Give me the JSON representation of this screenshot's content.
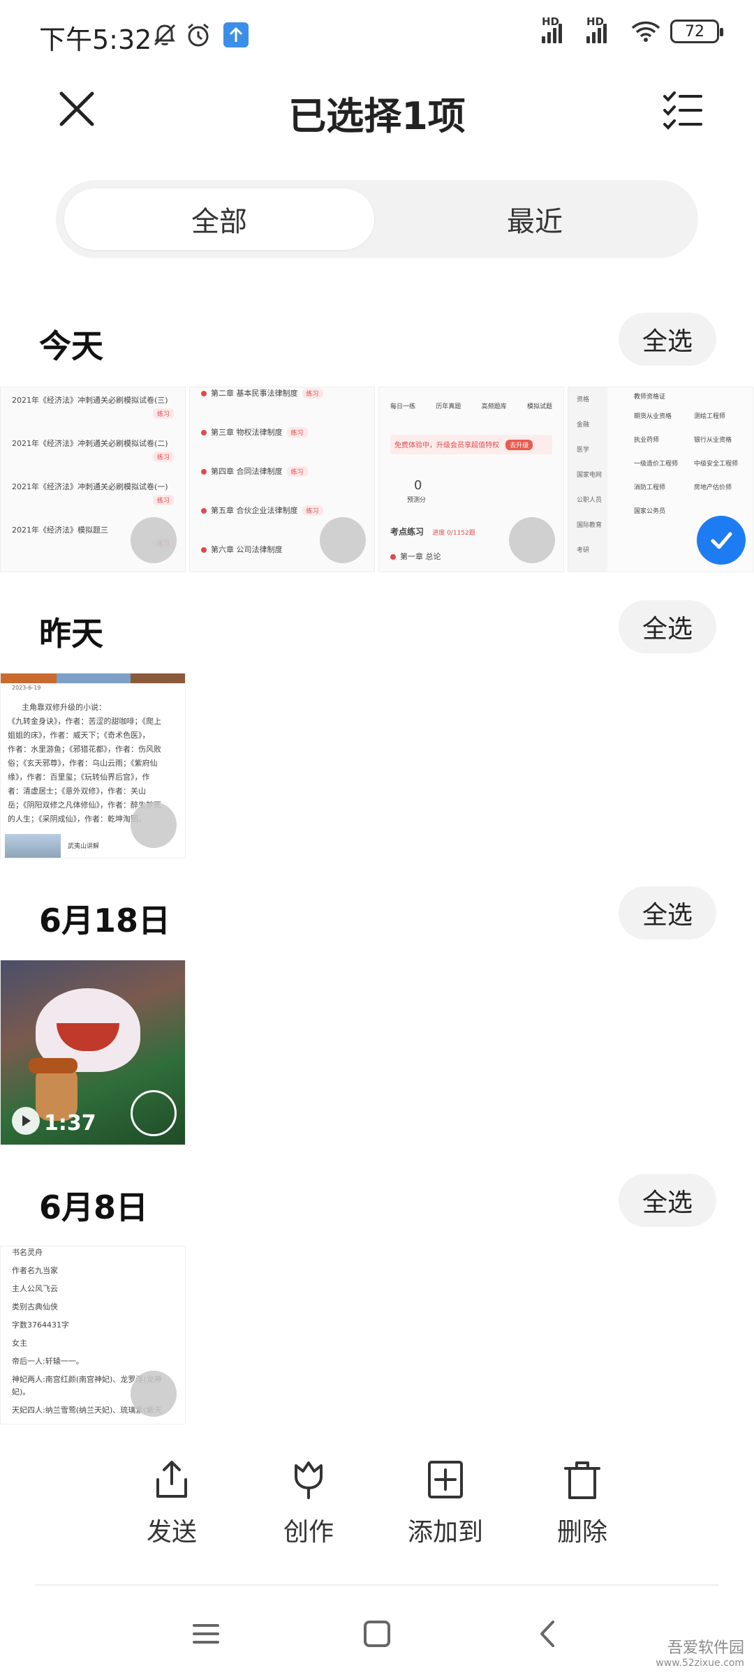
{
  "status_bar": {
    "time": "下午5:32",
    "battery": "72",
    "hd1": "HD",
    "hd2": "HD"
  },
  "header": {
    "title": "已选择1项"
  },
  "tabs": [
    {
      "label": "全部",
      "active": true
    },
    {
      "label": "最近",
      "active": false
    }
  ],
  "sections": [
    {
      "title": "今天",
      "select_all": "全选",
      "thumbs": [
        {
          "lines": [
            "2021年《经济法》冲刺通关必刷模拟试卷(三)",
            "2021年《经济法》冲刺通关必刷模拟试卷(二)",
            "2021年《经济法》冲刺通关必刷模拟试卷(一)",
            "2021年《经济法》模拟题三"
          ],
          "badge": "练习"
        },
        {
          "lines": [
            "第二章 基本民事法律制度",
            "第三章 物权法律制度",
            "第四章 合同法律制度",
            "第五章 合伙企业法律制度",
            "第六章 公司法律制度"
          ],
          "badge": "练习"
        },
        {
          "lines": [
            "每日一练",
            "历年真题",
            "高频题库",
            "模拟试题",
            "免费体验中，升级会员享超值特权",
            "去升级",
            "0",
            "预测分",
            "考点练习",
            "进度 0/1152题",
            "第一章 总论"
          ]
        },
        {
          "lines": [
            "资格",
            "金融",
            "医学",
            "国家电网",
            "公职人员",
            "国际教育",
            "考研",
            "期货从业资格",
            "测绘工程师",
            "执业药师",
            "银行从业资格",
            "一级造价工程师",
            "中级安全工程师",
            "消防工程师",
            "房地产估价师",
            "国家公务员",
            "教师资格证"
          ],
          "selected": true
        }
      ]
    },
    {
      "title": "昨天",
      "select_all": "全选",
      "thumbs": [
        {
          "lines": [
            "2023-6-19",
            "主角靠双修升级的小说：",
            "《九转金身诀》，作者：苦涩的甜咖啡；《爬上",
            "姐姐的床》，作者：威天下；《奇术色医》，",
            "作者：水里游鱼；《邪猎花都》，作者：伤风败",
            "俗；《玄天邪尊》，作者：乌山云雨；《紫府仙",
            "缘》，作者：百里玺；《玩转仙界后宫》，作",
            "者：清虚居士；《意外双修》，作者：关山",
            "岳；《阴阳双修之凡体修仙》，作者：醉生梦死",
            "的人生；《采阴成仙》，作者：乾坤淘图。",
            "武夷山讲解"
          ]
        }
      ]
    },
    {
      "title": "6月18日",
      "select_all": "全选",
      "thumbs": [
        {
          "video_duration": "1:37"
        }
      ]
    },
    {
      "title": "6月8日",
      "select_all": "全选",
      "thumbs": [
        {
          "lines": [
            "书名灵舟",
            "作者名九当家",
            "主人公风飞云",
            "类别古典仙侠",
            "字数3764431字",
            "女主",
            "帝后一人:轩辕一一。",
            "神妃两人:南宫红颜(南宫神妃)、龙罗浮(龙神",
            "妃)。",
            "天妃四人:纳兰雪莺(纳兰天妃)、琉璃紫(紫天"
          ]
        }
      ]
    }
  ],
  "actions": [
    {
      "label": "发送",
      "icon": "share-icon"
    },
    {
      "label": "创作",
      "icon": "tulip-icon"
    },
    {
      "label": "添加到",
      "icon": "add-box-icon"
    },
    {
      "label": "删除",
      "icon": "trash-icon"
    }
  ],
  "watermark": {
    "name": "吾爱软件园",
    "site": "www.52zixue.com"
  },
  "colors": {
    "accent": "#1e7cf2",
    "segment_bg": "#f2f2f2",
    "badge_red": "#e04a4a"
  }
}
